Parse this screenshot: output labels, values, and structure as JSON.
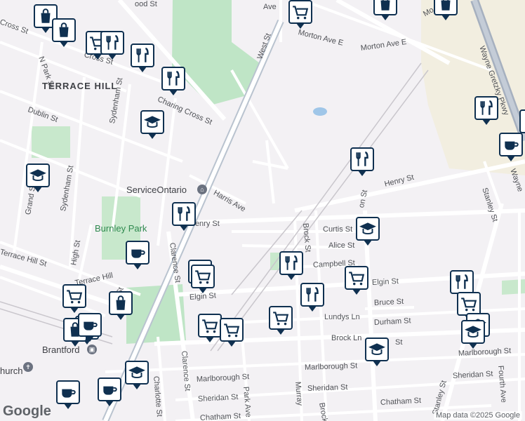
{
  "map": {
    "areas": [
      {
        "name": "TERRACE HILL"
      }
    ],
    "parks": [
      {
        "name": "Burnley Park"
      }
    ],
    "places": [
      {
        "name": "ServiceOntario"
      },
      {
        "name": "Brantford"
      },
      {
        "name": "hurch"
      }
    ],
    "streets": [
      "Morton Ave E",
      "Morton Ave E",
      "West St",
      "Charing Cross St",
      "Dublin St",
      "Sydenham St",
      "Harris Ave",
      "Henry St",
      "Henry St",
      "Stanley St",
      "Grand St",
      "Sydenham St",
      "High St",
      "Terrace Hill St",
      "Terrace Hill",
      "Clarence St",
      "Elgin St",
      "Elgin St",
      "Brock St",
      "Curtis St",
      "Alice St",
      "Campbell St",
      "Bruce St",
      "Lundys Ln",
      "Durham St",
      "Brock Ln",
      "Marlborough St",
      "Marlborough St",
      "Marlborough St",
      "Sheridan St",
      "Sheridan St",
      "Sheridan St",
      "Chatham St",
      "Chatham St",
      "Charlotte St",
      "Park Ave",
      "Clarence St",
      "Stanley St",
      "Fourth Ave",
      "Wayne Gretzky Pkwy",
      "N Park St",
      "Cross St",
      "Cross St",
      "West St",
      "Murray",
      "Brock St",
      "Wayne",
      "St",
      "ood St",
      "on St",
      "Ave",
      "Mo"
    ],
    "pins": [
      {
        "type": "shopping",
        "icon": "shopping-bag-icon"
      },
      {
        "type": "shopping",
        "icon": "shopping-bag-icon"
      },
      {
        "type": "grocery",
        "icon": "shopping-cart-icon"
      },
      {
        "type": "restaurant",
        "icon": "fork-knife-icon"
      },
      {
        "type": "restaurant",
        "icon": "fork-knife-icon"
      },
      {
        "type": "restaurant",
        "icon": "fork-knife-icon"
      },
      {
        "type": "school",
        "icon": "graduation-cap-icon"
      },
      {
        "type": "school",
        "icon": "graduation-cap-icon"
      },
      {
        "type": "grocery",
        "icon": "shopping-cart-icon"
      },
      {
        "type": "shopping",
        "icon": "shopping-bag-icon"
      },
      {
        "type": "shopping",
        "icon": "shopping-bag-icon"
      },
      {
        "type": "restaurant",
        "icon": "fork-knife-icon"
      },
      {
        "type": "cafe",
        "icon": "coffee-cup-icon"
      },
      {
        "type": "restaurant",
        "icon": "fork-knife-icon"
      },
      {
        "type": "restaurant",
        "icon": "fork-knife-icon"
      },
      {
        "type": "cafe",
        "icon": "coffee-cup-icon"
      },
      {
        "type": "school",
        "icon": "graduation-cap-icon"
      },
      {
        "type": "restaurant",
        "icon": "fork-knife-icon"
      },
      {
        "type": "grocery",
        "icon": "shopping-cart-icon"
      },
      {
        "type": "grocery",
        "icon": "shopping-cart-icon"
      },
      {
        "type": "grocery",
        "icon": "shopping-cart-icon"
      },
      {
        "type": "shopping",
        "icon": "shopping-bag-icon"
      },
      {
        "type": "restaurant",
        "icon": "fork-knife-icon"
      },
      {
        "type": "grocery",
        "icon": "shopping-cart-icon"
      },
      {
        "type": "grocery",
        "icon": "shopping-cart-icon"
      },
      {
        "type": "grocery",
        "icon": "shopping-cart-icon"
      },
      {
        "type": "restaurant",
        "icon": "fork-knife-icon"
      },
      {
        "type": "grocery",
        "icon": "shopping-cart-icon"
      },
      {
        "type": "restaurant",
        "icon": "fork-knife-icon"
      },
      {
        "type": "grocery",
        "icon": "shopping-cart-icon"
      },
      {
        "type": "school",
        "icon": "graduation-cap-icon"
      },
      {
        "type": "school",
        "icon": "graduation-cap-icon"
      },
      {
        "type": "shopping",
        "icon": "shopping-bag-icon"
      },
      {
        "type": "cafe",
        "icon": "coffee-cup-icon"
      },
      {
        "type": "school",
        "icon": "graduation-cap-icon"
      },
      {
        "type": "cafe",
        "icon": "coffee-cup-icon"
      },
      {
        "type": "cafe",
        "icon": "coffee-cup-icon"
      },
      {
        "type": "cafe",
        "icon": "coffee-cup-icon"
      }
    ],
    "brand": "Google",
    "attribution": "Map data ©2025 Google",
    "colors": {
      "pin_border": "#0f3050",
      "park": "#bfe5c6",
      "road": "#ffffff",
      "highway": "#a6b0bf"
    }
  }
}
